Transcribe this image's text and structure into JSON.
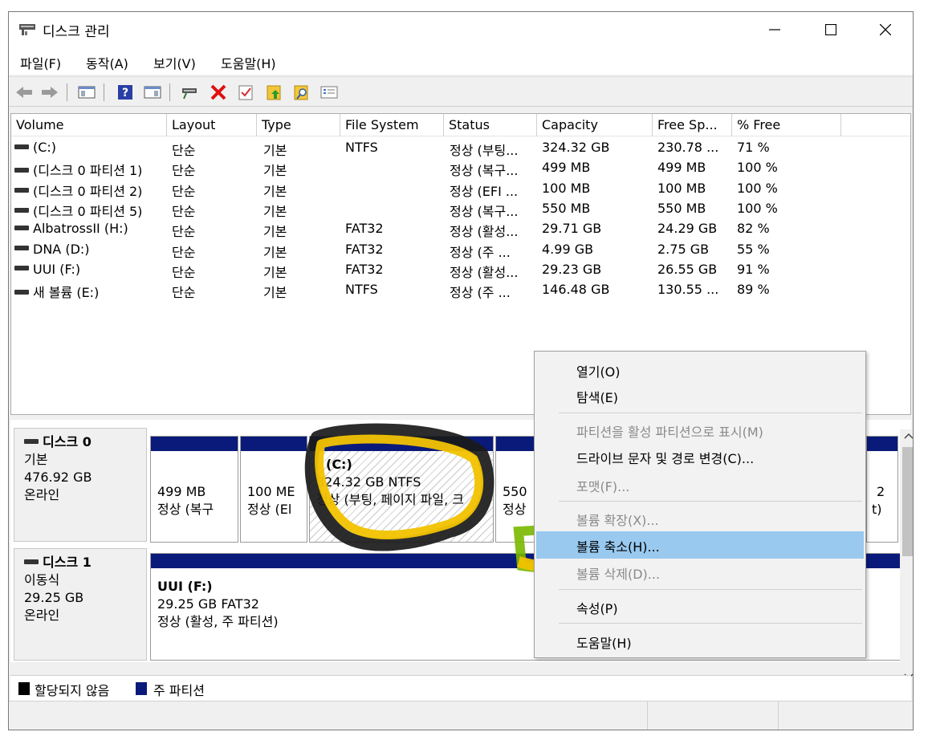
{
  "window": {
    "title": "디스크 관리",
    "minimize_icon": "minimize-icon",
    "maximize_icon": "maximize-icon",
    "close_icon": "close-icon"
  },
  "menu": [
    "파일(F)",
    "동작(A)",
    "보기(V)",
    "도움말(H)"
  ],
  "toolbar_icons": [
    "back-arrow-icon",
    "forward-arrow-icon",
    "console-tree-icon",
    "help-icon",
    "action-pane-icon",
    "connect-drive-icon",
    "delete-icon",
    "properties-icon",
    "folder-up-icon",
    "search-folder-icon",
    "list-view-icon"
  ],
  "columns": [
    "Volume",
    "Layout",
    "Type",
    "File System",
    "Status",
    "Capacity",
    "Free Sp...",
    "% Free"
  ],
  "volumes": [
    {
      "volume": "(C:)",
      "layout": "단순",
      "type": "기본",
      "fs": "NTFS",
      "status": "정상 (부팅...",
      "capacity": "324.32 GB",
      "free": "230.78 ...",
      "pct": "71 %"
    },
    {
      "volume": "(디스크 0 파티션 1)",
      "layout": "단순",
      "type": "기본",
      "fs": "",
      "status": "정상 (복구...",
      "capacity": "499 MB",
      "free": "499 MB",
      "pct": "100 %"
    },
    {
      "volume": "(디스크 0 파티션 2)",
      "layout": "단순",
      "type": "기본",
      "fs": "",
      "status": "정상 (EFI ...",
      "capacity": "100 MB",
      "free": "100 MB",
      "pct": "100 %"
    },
    {
      "volume": "(디스크 0 파티션 5)",
      "layout": "단순",
      "type": "기본",
      "fs": "",
      "status": "정상 (복구...",
      "capacity": "550 MB",
      "free": "550 MB",
      "pct": "100 %"
    },
    {
      "volume": "AlbatrossII (H:)",
      "layout": "단순",
      "type": "기본",
      "fs": "FAT32",
      "status": "정상 (활성...",
      "capacity": "29.71 GB",
      "free": "24.29 GB",
      "pct": "82 %"
    },
    {
      "volume": "DNA (D:)",
      "layout": "단순",
      "type": "기본",
      "fs": "FAT32",
      "status": "정상 (주 ...",
      "capacity": "4.99 GB",
      "free": "2.75 GB",
      "pct": "55 %"
    },
    {
      "volume": "UUI (F:)",
      "layout": "단순",
      "type": "기본",
      "fs": "FAT32",
      "status": "정상 (활성...",
      "capacity": "29.23 GB",
      "free": "26.55 GB",
      "pct": "91 %"
    },
    {
      "volume": "새 볼륨 (E:)",
      "layout": "단순",
      "type": "기본",
      "fs": "NTFS",
      "status": "정상 (주 ...",
      "capacity": "146.48 GB",
      "free": "130.55 ...",
      "pct": "89 %"
    }
  ],
  "disk0": {
    "name": "디스크 0",
    "kind": "기본",
    "size": "476.92 GB",
    "state": "온라인",
    "parts": [
      {
        "l1": "499 MB",
        "l2": "정상 (복구"
      },
      {
        "l1": "100 ME",
        "l2": "정상 (El"
      },
      {
        "l1": "(C:)",
        "l2": "324.32 GB NTFS",
        "l3": "정상 (부팅, 페이지 파일, 크"
      },
      {
        "l1": "550",
        "l2": "정상"
      }
    ],
    "tail_fragments": [
      "2",
      "t)"
    ]
  },
  "disk1": {
    "name": "디스크 1",
    "kind": "이동식",
    "size": "29.25 GB",
    "state": "온라인",
    "part": {
      "l1": "UUI  (F:)",
      "l2": "29.25 GB FAT32",
      "l3": "정상 (활성, 주 파티션)"
    }
  },
  "legend": {
    "unallocated": "할당되지 않음",
    "primary": "주 파티션",
    "unallocated_color": "#000000",
    "primary_color": "#0a1a7a"
  },
  "context_menu": {
    "open": "열기(O)",
    "explore": "탐색(E)",
    "mark_active": "파티션을 활성 파티션으로 표시(M)",
    "change_letter": "드라이브 문자 및 경로 변경(C)...",
    "format": "포맷(F)...",
    "extend": "볼륨 확장(X)...",
    "shrink": "볼륨 축소(H)...",
    "delete": "볼륨 삭제(D)...",
    "properties": "속성(P)",
    "help": "도움말(H)",
    "highlight_color": "#99c9ef"
  },
  "annotation_colors": {
    "marker_yellow": "#f2c300",
    "marker_green": "#7ab800"
  }
}
